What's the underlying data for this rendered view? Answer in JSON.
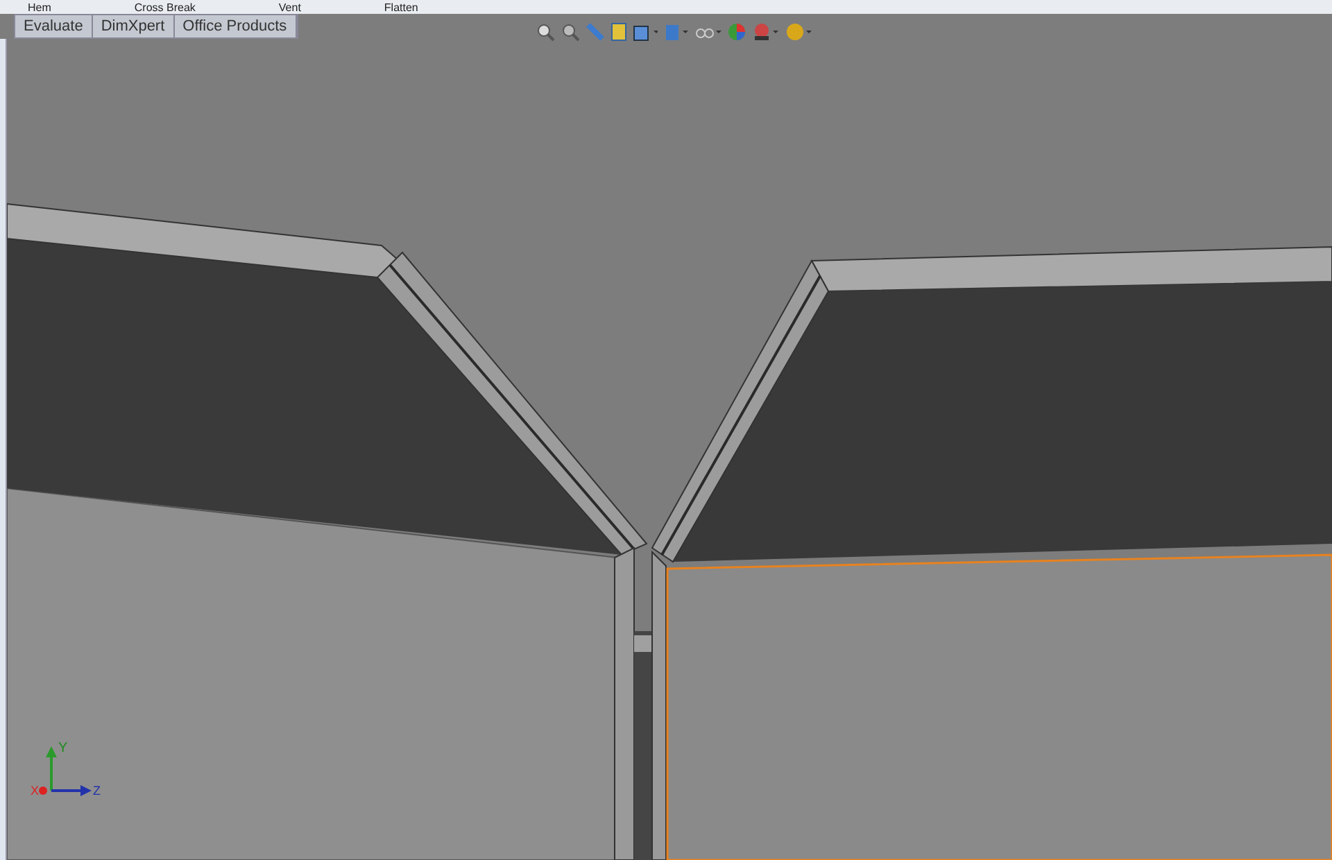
{
  "ribbon": {
    "items": [
      "Hem",
      "Cross Break",
      "Vent",
      "Flatten"
    ]
  },
  "tabs": [
    {
      "label": "Evaluate"
    },
    {
      "label": "DimXpert"
    },
    {
      "label": "Office Products"
    }
  ],
  "triad": {
    "x": "X",
    "y": "Y",
    "z": "Z"
  }
}
